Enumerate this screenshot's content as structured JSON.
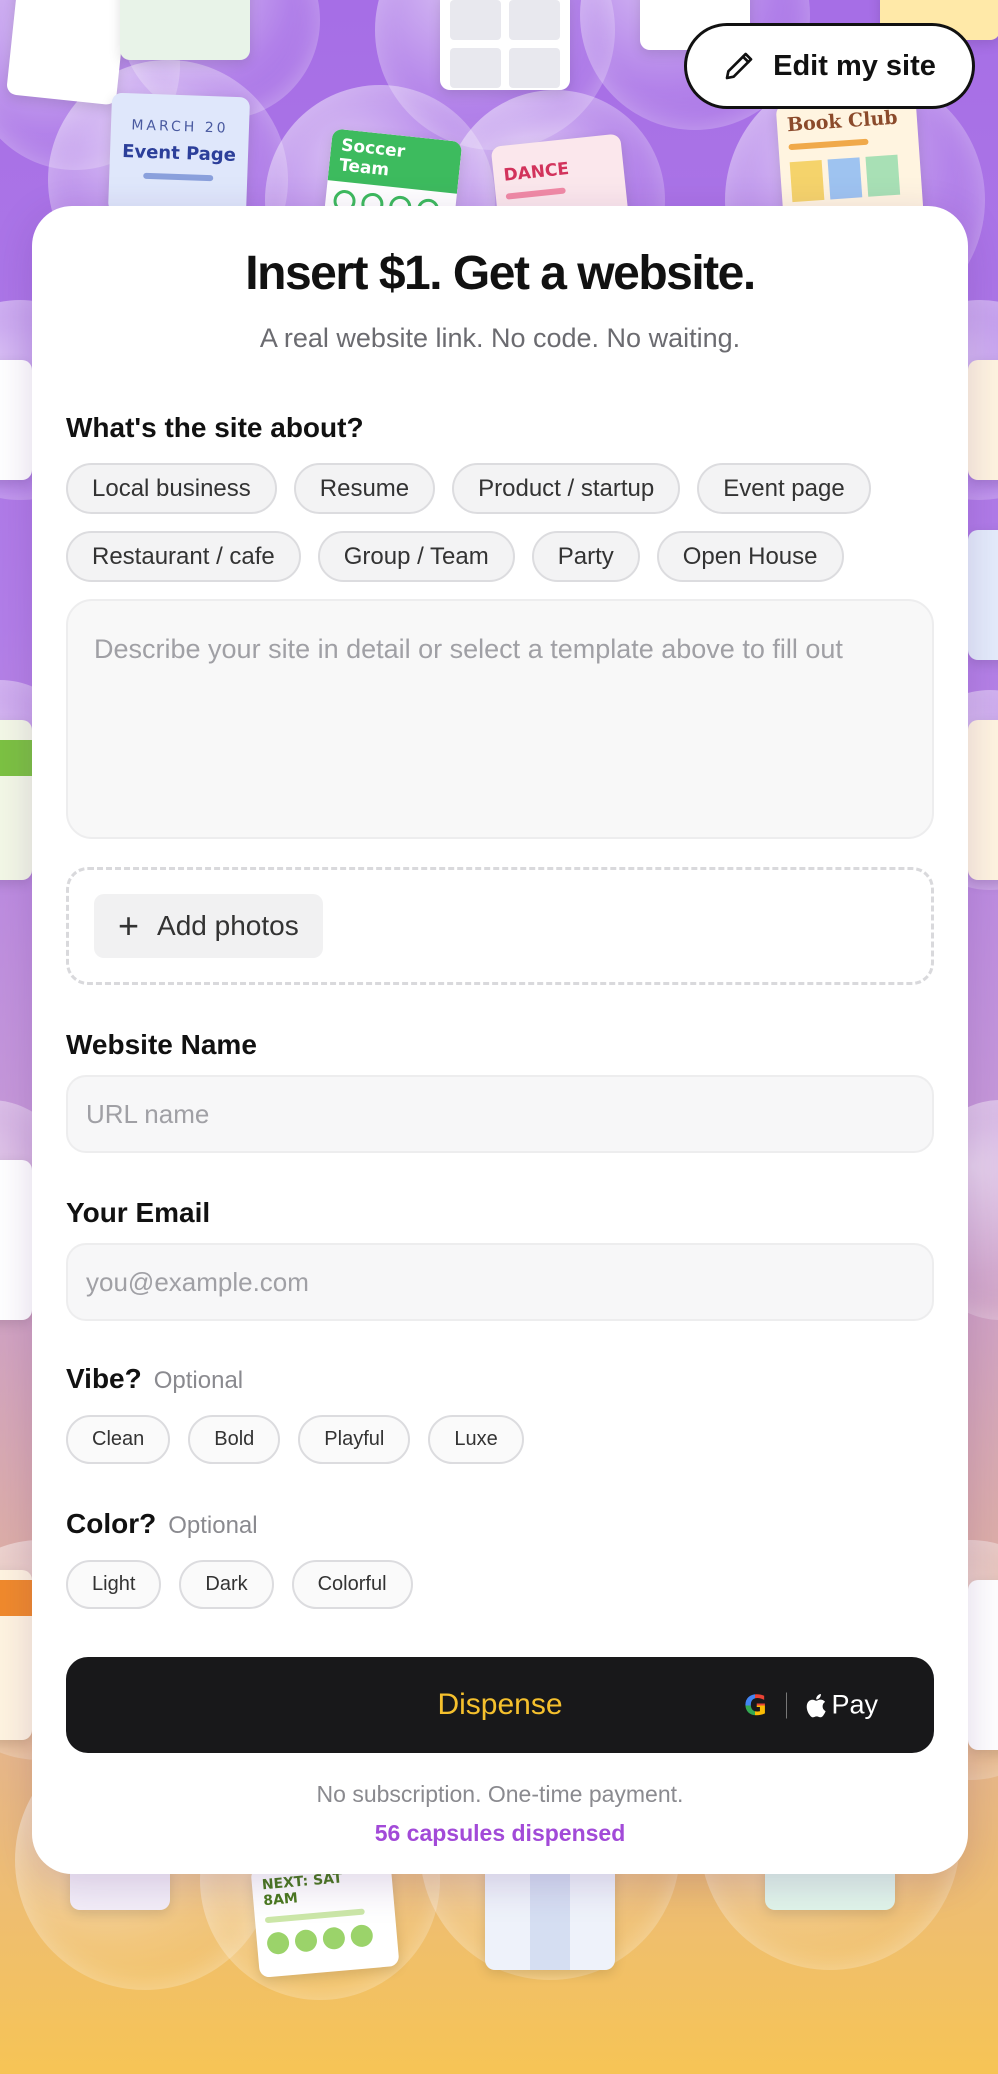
{
  "header": {
    "edit_button_label": "Edit my site"
  },
  "background_cards": {
    "event_page": {
      "date": "MARCH 20",
      "title": "Event Page"
    },
    "soccer": {
      "title": "Soccer Team"
    },
    "dance": {
      "title": "DANCE"
    },
    "book_club": {
      "title": "Book Club"
    },
    "next_game": {
      "title": "NEXT: SAT 8AM"
    }
  },
  "hero": {
    "title": "Insert $1. Get a website.",
    "subtitle": "A real website link. No code. No waiting."
  },
  "topic": {
    "label": "What's the site about?",
    "chips": [
      "Local business",
      "Resume",
      "Product / startup",
      "Event page",
      "Restaurant / cafe",
      "Group / Team",
      "Party",
      "Open House"
    ],
    "description_placeholder": "Describe your site in detail or select a template above to fill out",
    "add_photos_label": "Add photos"
  },
  "website_name": {
    "label": "Website Name",
    "placeholder": "URL name"
  },
  "email": {
    "label": "Your Email",
    "placeholder": "you@example.com"
  },
  "vibe": {
    "label": "Vibe?",
    "optional": "Optional",
    "options": [
      "Clean",
      "Bold",
      "Playful",
      "Luxe"
    ]
  },
  "color": {
    "label": "Color?",
    "optional": "Optional",
    "options": [
      "Light",
      "Dark",
      "Colorful"
    ]
  },
  "checkout": {
    "dispense_label": "Dispense",
    "google_pay_icon": "G",
    "apple_pay_label": "Pay",
    "dispense_text_color": "#f5c02d",
    "footnote": "No subscription. One-time payment.",
    "counter": "56 capsules dispensed",
    "counter_color": "#a24ad8"
  }
}
